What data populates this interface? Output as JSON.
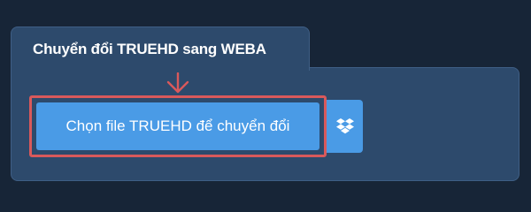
{
  "converter": {
    "title": "Chuyển đổi TRUEHD sang WEBA",
    "upload_button_label": "Chọn file TRUEHD để chuyển đổi",
    "dropbox_icon": "dropbox-icon",
    "arrow_icon": "arrow-down-icon"
  },
  "colors": {
    "page_background": "#172537",
    "panel_background": "#2d4a6c",
    "button_blue": "#4a9be6",
    "highlight_red": "#d9595b"
  }
}
